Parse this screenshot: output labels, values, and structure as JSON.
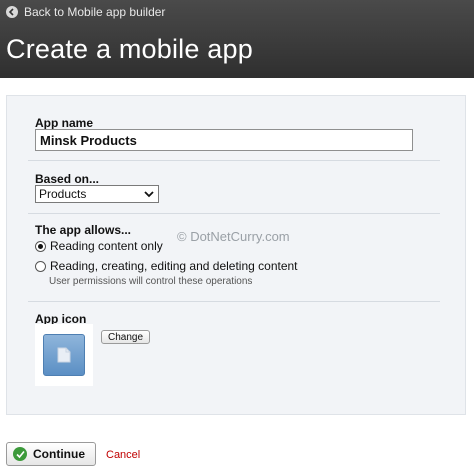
{
  "header": {
    "back_link": "Back to Mobile app builder",
    "title": "Create a mobile app"
  },
  "form": {
    "app_name": {
      "label": "App name",
      "value": "Minsk Products"
    },
    "based_on": {
      "label": "Based on...",
      "selected": "Products"
    },
    "allows": {
      "label": "The app allows...",
      "options": [
        {
          "label": "Reading content only",
          "checked": true
        },
        {
          "label": "Reading, creating, editing and deleting content",
          "checked": false
        }
      ],
      "hint": "User permissions will control these operations"
    },
    "app_icon": {
      "label": "App icon",
      "change_label": "Change"
    }
  },
  "watermark": "© DotNetCurry.com",
  "actions": {
    "continue_label": "Continue",
    "cancel_label": "Cancel"
  },
  "colors": {
    "header_bg": "#3a3a3a",
    "panel_bg": "#f2f4f7",
    "accent_green": "#3c9a3a",
    "cancel_red": "#c00000"
  }
}
